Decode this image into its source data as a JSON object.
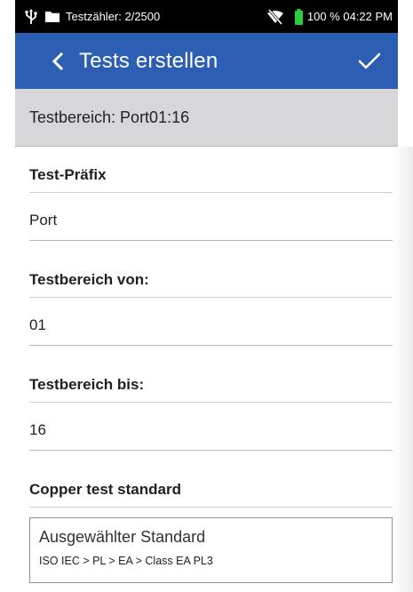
{
  "status_bar": {
    "test_counter": "Testzähler: 2/2500",
    "battery_time": "100 % 04:22 PM",
    "icons": [
      "usb-icon",
      "folder-icon",
      "no-signal-icon",
      "battery-icon"
    ],
    "battery_color": "#2ecc40"
  },
  "app_bar": {
    "title": "Tests erstellen",
    "back_icon": "chevron-left-icon",
    "confirm_icon": "checkmark-icon",
    "color": "#2c5fb4"
  },
  "range_header": {
    "text": "Testbereich: Port01:16"
  },
  "form": {
    "prefix_label": "Test-Präfix",
    "prefix_value": "Port",
    "from_label": "Testbereich von:",
    "from_value": "01",
    "to_label": "Testbereich bis:",
    "to_value": "16",
    "standard_label": "Copper test standard",
    "standard_box_title": "Ausgewählter Standard",
    "standard_box_path": "ISO IEC > PL > EA > Class EA PL3"
  }
}
